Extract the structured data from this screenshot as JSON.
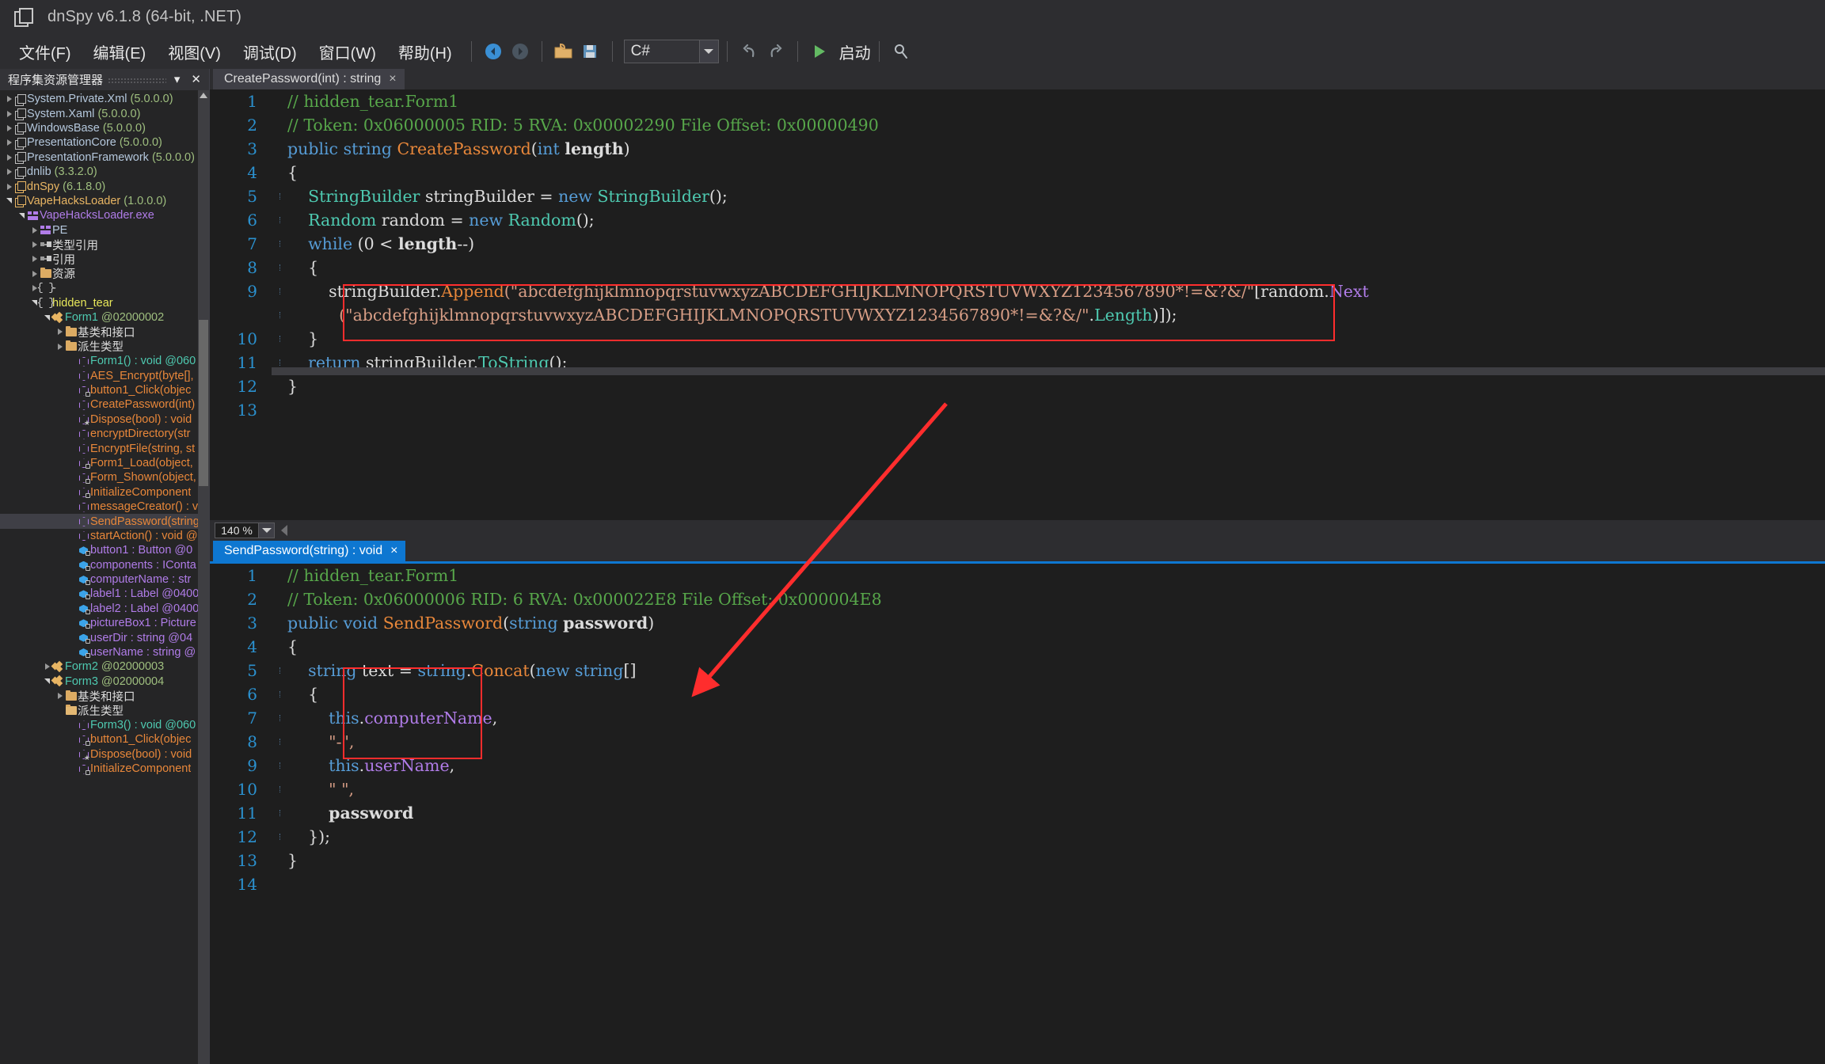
{
  "window": {
    "title": "dnSpy v6.1.8 (64-bit, .NET)",
    "icon": "window-icon"
  },
  "menubar": {
    "items": [
      {
        "label": "文件(F)",
        "name": "menu-file"
      },
      {
        "label": "编辑(E)",
        "name": "menu-edit"
      },
      {
        "label": "视图(V)",
        "name": "menu-view"
      },
      {
        "label": "调试(D)",
        "name": "menu-debug"
      },
      {
        "label": "窗口(W)",
        "name": "menu-window"
      },
      {
        "label": "帮助(H)",
        "name": "menu-help"
      }
    ],
    "toolbar": {
      "back_icon": "back-arrow-icon",
      "forward_icon": "forward-arrow-icon",
      "open_icon": "open-folder-icon",
      "save_icon": "save-icon",
      "language_value": "C#",
      "undo_icon": "undo-icon",
      "redo_icon": "redo-icon",
      "start_icon": "play-icon",
      "start_label": "启动",
      "search_icon": "search-icon"
    }
  },
  "tree_panel": {
    "title": "程序集资源管理器",
    "menu_icon": "chevron-down-icon",
    "close_icon": "close-icon",
    "rows": [
      {
        "indent": 0,
        "expander": "collapsed",
        "icon": "assembly-icon",
        "text": "System.Private.Xml",
        "ver": " (5.0.0.0)",
        "cls": "c-asmname"
      },
      {
        "indent": 0,
        "expander": "collapsed",
        "icon": "assembly-icon",
        "text": "System.Xaml",
        "ver": " (5.0.0.0)",
        "cls": "c-asmname"
      },
      {
        "indent": 0,
        "expander": "collapsed",
        "icon": "assembly-icon",
        "text": "WindowsBase",
        "ver": " (5.0.0.0)",
        "cls": "c-asmname"
      },
      {
        "indent": 0,
        "expander": "collapsed",
        "icon": "assembly-icon",
        "text": "PresentationCore",
        "ver": " (5.0.0.0)",
        "cls": "c-asmname"
      },
      {
        "indent": 0,
        "expander": "collapsed",
        "icon": "assembly-icon",
        "text": "PresentationFramework",
        "ver": " (5.0.0.0)",
        "cls": "c-asmname"
      },
      {
        "indent": 0,
        "expander": "collapsed",
        "icon": "assembly-icon",
        "text": "dnlib",
        "ver": " (3.3.2.0)",
        "cls": "c-asmname"
      },
      {
        "indent": 0,
        "expander": "collapsed",
        "icon": "assembly-icon-gold",
        "text": "dnSpy",
        "ver": " (6.1.8.0)",
        "cls": "c-gold"
      },
      {
        "indent": 0,
        "expander": "expanded",
        "icon": "assembly-icon-gold",
        "text": "VapeHacksLoader",
        "ver": " (1.0.0.0)",
        "cls": "c-gold"
      },
      {
        "indent": 1,
        "expander": "expanded",
        "icon": "module-icon",
        "text": "VapeHacksLoader.exe",
        "ver": "",
        "cls": "c-module"
      },
      {
        "indent": 2,
        "expander": "collapsed",
        "icon": "module-icon",
        "text": "PE",
        "ver": "",
        "cls": "c-asmname"
      },
      {
        "indent": 2,
        "expander": "collapsed",
        "icon": "reference-icon",
        "text": "类型引用",
        "ver": "",
        "cls": "c-plain"
      },
      {
        "indent": 2,
        "expander": "collapsed",
        "icon": "reference-icon",
        "text": "引用",
        "ver": "",
        "cls": "c-plain"
      },
      {
        "indent": 2,
        "expander": "collapsed",
        "icon": "folder-icon",
        "text": "资源",
        "ver": "",
        "cls": "c-plain"
      },
      {
        "indent": 2,
        "expander": "collapsed",
        "icon": "namespace-icon",
        "text": "-",
        "ver": "",
        "cls": "c-plain"
      },
      {
        "indent": 2,
        "expander": "expanded",
        "icon": "namespace-icon",
        "text": "hidden_tear",
        "ver": "",
        "cls": "c-ns"
      },
      {
        "indent": 3,
        "expander": "expanded",
        "icon": "class-icon",
        "text": "Form1",
        "ver": " @02000002",
        "cls": "c-type"
      },
      {
        "indent": 4,
        "expander": "collapsed",
        "icon": "folder-icon",
        "text": "基类和接口",
        "ver": "",
        "cls": "c-plain"
      },
      {
        "indent": 4,
        "expander": "collapsed",
        "icon": "folder-icon",
        "text": "派生类型",
        "ver": "",
        "cls": "c-plain"
      },
      {
        "indent": 5,
        "expander": "none",
        "icon": "method-icon",
        "text": "Form1() : void @060",
        "ver": "",
        "cls": "c-type-mix"
      },
      {
        "indent": 5,
        "expander": "none",
        "icon": "method-icon",
        "text": "AES_Encrypt(byte[],",
        "ver": "",
        "cls": "c-method"
      },
      {
        "indent": 5,
        "expander": "none",
        "icon": "method-icon-lock",
        "text": "button1_Click(objec",
        "ver": "",
        "cls": "c-method"
      },
      {
        "indent": 5,
        "expander": "none",
        "icon": "method-icon",
        "text": "CreatePassword(int)",
        "ver": "",
        "cls": "c-method"
      },
      {
        "indent": 5,
        "expander": "none",
        "icon": "method-icon-star",
        "text": "Dispose(bool) : void",
        "ver": "",
        "cls": "c-method"
      },
      {
        "indent": 5,
        "expander": "none",
        "icon": "method-icon",
        "text": "encryptDirectory(str",
        "ver": "",
        "cls": "c-method"
      },
      {
        "indent": 5,
        "expander": "none",
        "icon": "method-icon",
        "text": "EncryptFile(string, st",
        "ver": "",
        "cls": "c-method"
      },
      {
        "indent": 5,
        "expander": "none",
        "icon": "method-icon-lock",
        "text": "Form1_Load(object,",
        "ver": "",
        "cls": "c-method"
      },
      {
        "indent": 5,
        "expander": "none",
        "icon": "method-icon-lock",
        "text": "Form_Shown(object,",
        "ver": "",
        "cls": "c-method"
      },
      {
        "indent": 5,
        "expander": "none",
        "icon": "method-icon-lock",
        "text": "InitializeComponent",
        "ver": "",
        "cls": "c-method"
      },
      {
        "indent": 5,
        "expander": "none",
        "icon": "method-icon",
        "text": "messageCreator() : v",
        "ver": "",
        "cls": "c-method"
      },
      {
        "indent": 5,
        "expander": "none",
        "icon": "method-icon",
        "text": "SendPassword(string",
        "ver": "",
        "cls": "c-method",
        "selected": true
      },
      {
        "indent": 5,
        "expander": "none",
        "icon": "method-icon",
        "text": "startAction() : void @",
        "ver": "",
        "cls": "c-method"
      },
      {
        "indent": 5,
        "expander": "none",
        "icon": "field-icon-lock",
        "text": "button1 : Button @0",
        "ver": "",
        "cls": "c-field"
      },
      {
        "indent": 5,
        "expander": "none",
        "icon": "field-icon-lock",
        "text": "components : IConta",
        "ver": "",
        "cls": "c-field"
      },
      {
        "indent": 5,
        "expander": "none",
        "icon": "field-icon-lock",
        "text": "computerName : str",
        "ver": "",
        "cls": "c-field"
      },
      {
        "indent": 5,
        "expander": "none",
        "icon": "field-icon-lock",
        "text": "label1 : Label @0400",
        "ver": "",
        "cls": "c-field"
      },
      {
        "indent": 5,
        "expander": "none",
        "icon": "field-icon-lock",
        "text": "label2 : Label @0400",
        "ver": "",
        "cls": "c-field"
      },
      {
        "indent": 5,
        "expander": "none",
        "icon": "field-icon-lock",
        "text": "pictureBox1 : Picture",
        "ver": "",
        "cls": "c-field"
      },
      {
        "indent": 5,
        "expander": "none",
        "icon": "field-icon-lock",
        "text": "userDir : string @04",
        "ver": "",
        "cls": "c-field"
      },
      {
        "indent": 5,
        "expander": "none",
        "icon": "field-icon-lock",
        "text": "userName : string @",
        "ver": "",
        "cls": "c-field"
      },
      {
        "indent": 3,
        "expander": "collapsed",
        "icon": "class-icon",
        "text": "Form2",
        "ver": " @02000003",
        "cls": "c-type"
      },
      {
        "indent": 3,
        "expander": "expanded",
        "icon": "class-icon",
        "text": "Form3",
        "ver": " @02000004",
        "cls": "c-type"
      },
      {
        "indent": 4,
        "expander": "collapsed",
        "icon": "folder-icon",
        "text": "基类和接口",
        "ver": "",
        "cls": "c-plain"
      },
      {
        "indent": 4,
        "expander": "none",
        "icon": "folder-icon-open",
        "text": "派生类型",
        "ver": "",
        "cls": "c-plain"
      },
      {
        "indent": 5,
        "expander": "none",
        "icon": "method-icon",
        "text": "Form3() : void @060",
        "ver": "",
        "cls": "c-type-mix"
      },
      {
        "indent": 5,
        "expander": "none",
        "icon": "method-icon-lock",
        "text": "button1_Click(objec",
        "ver": "",
        "cls": "c-method"
      },
      {
        "indent": 5,
        "expander": "none",
        "icon": "method-icon-star",
        "text": "Dispose(bool) : void",
        "ver": "",
        "cls": "c-method"
      },
      {
        "indent": 5,
        "expander": "none",
        "icon": "method-icon-lock",
        "text": "InitializeComponent",
        "ver": "",
        "cls": "c-method"
      }
    ]
  },
  "editor_top": {
    "tab_label": "CreatePassword(int) : string",
    "tab_close": "×",
    "lines": [
      {
        "n": "1",
        "segs": [
          {
            "t": "// hidden_tear.Form1",
            "c": "t-cmt"
          }
        ]
      },
      {
        "n": "2",
        "segs": [
          {
            "t": "// Token: 0x06000005 RID: 5 RVA: 0x00002290 File Offset: 0x00000490",
            "c": "t-cmt"
          }
        ]
      },
      {
        "n": "3",
        "segs": [
          {
            "t": "public ",
            "c": "t-kw"
          },
          {
            "t": "string ",
            "c": "t-kw"
          },
          {
            "t": "CreatePassword",
            "c": "t-mth"
          },
          {
            "t": "(",
            "c": "t-txt"
          },
          {
            "t": "int ",
            "c": "t-kw"
          },
          {
            "t": "length",
            "c": "t-par"
          },
          {
            "t": ")",
            "c": "t-txt"
          }
        ]
      },
      {
        "n": "4",
        "segs": [
          {
            "t": "{",
            "c": "t-txt"
          }
        ]
      },
      {
        "n": "5",
        "guide": true,
        "segs": [
          {
            "t": "    ",
            "c": "t-txt"
          },
          {
            "t": "StringBuilder",
            "c": "t-type"
          },
          {
            "t": " stringBuilder = ",
            "c": "t-txt"
          },
          {
            "t": "new ",
            "c": "t-kw"
          },
          {
            "t": "StringBuilder",
            "c": "t-type"
          },
          {
            "t": "();",
            "c": "t-txt"
          }
        ]
      },
      {
        "n": "6",
        "guide": true,
        "segs": [
          {
            "t": "    ",
            "c": "t-txt"
          },
          {
            "t": "Random",
            "c": "t-type"
          },
          {
            "t": " random = ",
            "c": "t-txt"
          },
          {
            "t": "new ",
            "c": "t-kw"
          },
          {
            "t": "Random",
            "c": "t-type"
          },
          {
            "t": "();",
            "c": "t-txt"
          }
        ]
      },
      {
        "n": "7",
        "guide": true,
        "segs": [
          {
            "t": "    ",
            "c": "t-txt"
          },
          {
            "t": "while ",
            "c": "t-kw"
          },
          {
            "t": "(0 ",
            "c": "t-txt"
          },
          {
            "t": "<",
            "c": "t-txt"
          },
          {
            "t": " ",
            "c": "t-txt"
          },
          {
            "t": "length",
            "c": "t-par"
          },
          {
            "t": "--)",
            "c": "t-txt"
          }
        ]
      },
      {
        "n": "8",
        "guide": true,
        "segs": [
          {
            "t": "    {",
            "c": "t-txt"
          }
        ]
      },
      {
        "n": "9",
        "guide": true,
        "segs": [
          {
            "t": "        stringBuilder.",
            "c": "t-txt"
          },
          {
            "t": "Append",
            "c": "t-mth"
          },
          {
            "t": "(\"abcdefghijklmnopqrstuvwxyzABCDEFGHIJKLMNOPQRSTUVWXYZ1234567890*!=&?&/\"",
            "c": "t-str"
          },
          {
            "t": "[random.",
            "c": "t-txt"
          },
          {
            "t": "Next",
            "c": "t-prop"
          }
        ]
      },
      {
        "n": "",
        "guide": true,
        "segs": [
          {
            "t": "          (\"abcdefghijklmnopqrstuvwxyzABCDEFGHIJKLMNOPQRSTUVWXYZ1234567890*!=&?&/\"",
            "c": "t-str"
          },
          {
            "t": ".",
            "c": "t-txt"
          },
          {
            "t": "Length",
            "c": "t-type"
          },
          {
            "t": ")]);",
            "c": "t-txt"
          }
        ]
      },
      {
        "n": "10",
        "guide": true,
        "segs": [
          {
            "t": "    }",
            "c": "t-txt"
          }
        ]
      },
      {
        "n": "11",
        "guide": true,
        "segs": [
          {
            "t": "    ",
            "c": "t-txt"
          },
          {
            "t": "return ",
            "c": "t-kw"
          },
          {
            "t": "stringBuilder.",
            "c": "t-txt"
          },
          {
            "t": "ToString",
            "c": "t-type"
          },
          {
            "t": "();",
            "c": "t-txt"
          }
        ]
      },
      {
        "n": "12",
        "segs": [
          {
            "t": "}",
            "c": "t-txt"
          }
        ]
      },
      {
        "n": "13",
        "segs": [
          {
            "t": "",
            "c": "t-txt"
          }
        ]
      }
    ]
  },
  "zoom_bar": {
    "value": "140 %",
    "dropdown_icon": "chevron-down-icon",
    "collapse_icon": "left-triangle-icon"
  },
  "editor_bottom": {
    "tab_label": "SendPassword(string) : void",
    "tab_close": "×",
    "lines": [
      {
        "n": "1",
        "segs": [
          {
            "t": "// hidden_tear.Form1",
            "c": "t-cmt"
          }
        ]
      },
      {
        "n": "2",
        "segs": [
          {
            "t": "// Token: 0x06000006 RID: 6 RVA: 0x000022E8 File Offset: 0x000004E8",
            "c": "t-cmt"
          }
        ]
      },
      {
        "n": "3",
        "segs": [
          {
            "t": "public ",
            "c": "t-kw"
          },
          {
            "t": "void ",
            "c": "t-kw"
          },
          {
            "t": "SendPassword",
            "c": "t-mth"
          },
          {
            "t": "(",
            "c": "t-txt"
          },
          {
            "t": "string ",
            "c": "t-kw"
          },
          {
            "t": "password",
            "c": "t-par"
          },
          {
            "t": ")",
            "c": "t-txt"
          }
        ]
      },
      {
        "n": "4",
        "segs": [
          {
            "t": "{",
            "c": "t-txt"
          }
        ]
      },
      {
        "n": "5",
        "guide": true,
        "segs": [
          {
            "t": "    ",
            "c": "t-txt"
          },
          {
            "t": "string ",
            "c": "t-kw"
          },
          {
            "t": "text = ",
            "c": "t-txt"
          },
          {
            "t": "string",
            "c": "t-kw"
          },
          {
            "t": ".",
            "c": "t-txt"
          },
          {
            "t": "Concat",
            "c": "t-mth"
          },
          {
            "t": "(",
            "c": "t-txt"
          },
          {
            "t": "new ",
            "c": "t-kw"
          },
          {
            "t": "string",
            "c": "t-kw"
          },
          {
            "t": "[]",
            "c": "t-txt"
          }
        ]
      },
      {
        "n": "6",
        "guide": true,
        "segs": [
          {
            "t": "    {",
            "c": "t-txt"
          }
        ]
      },
      {
        "n": "7",
        "guide": true,
        "segs": [
          {
            "t": "        ",
            "c": "t-txt"
          },
          {
            "t": "this",
            "c": "t-kw"
          },
          {
            "t": ".",
            "c": "t-txt"
          },
          {
            "t": "computerName",
            "c": "t-prop"
          },
          {
            "t": ",",
            "c": "t-txt"
          }
        ]
      },
      {
        "n": "8",
        "guide": true,
        "segs": [
          {
            "t": "        ",
            "c": "t-txt"
          },
          {
            "t": "\"-\",",
            "c": "t-str"
          }
        ]
      },
      {
        "n": "9",
        "guide": true,
        "segs": [
          {
            "t": "        ",
            "c": "t-txt"
          },
          {
            "t": "this",
            "c": "t-kw"
          },
          {
            "t": ".",
            "c": "t-txt"
          },
          {
            "t": "userName",
            "c": "t-prop"
          },
          {
            "t": ",",
            "c": "t-txt"
          }
        ]
      },
      {
        "n": "10",
        "guide": true,
        "segs": [
          {
            "t": "        ",
            "c": "t-txt"
          },
          {
            "t": "\" \",",
            "c": "t-str"
          }
        ]
      },
      {
        "n": "11",
        "guide": true,
        "segs": [
          {
            "t": "        ",
            "c": "t-txt"
          },
          {
            "t": "password",
            "c": "t-par"
          }
        ]
      },
      {
        "n": "12",
        "guide": true,
        "segs": [
          {
            "t": "    });",
            "c": "t-txt"
          }
        ]
      },
      {
        "n": "13",
        "segs": [
          {
            "t": "}",
            "c": "t-txt"
          }
        ]
      },
      {
        "n": "14",
        "segs": [
          {
            "t": "",
            "c": "t-txt"
          }
        ]
      }
    ]
  },
  "annotations": {
    "box_top": "highlight-box-append-charset",
    "box_bottom": "highlight-box-concat-args",
    "arrow": "red-arrow-pointer",
    "color": "#ff2d2d"
  }
}
